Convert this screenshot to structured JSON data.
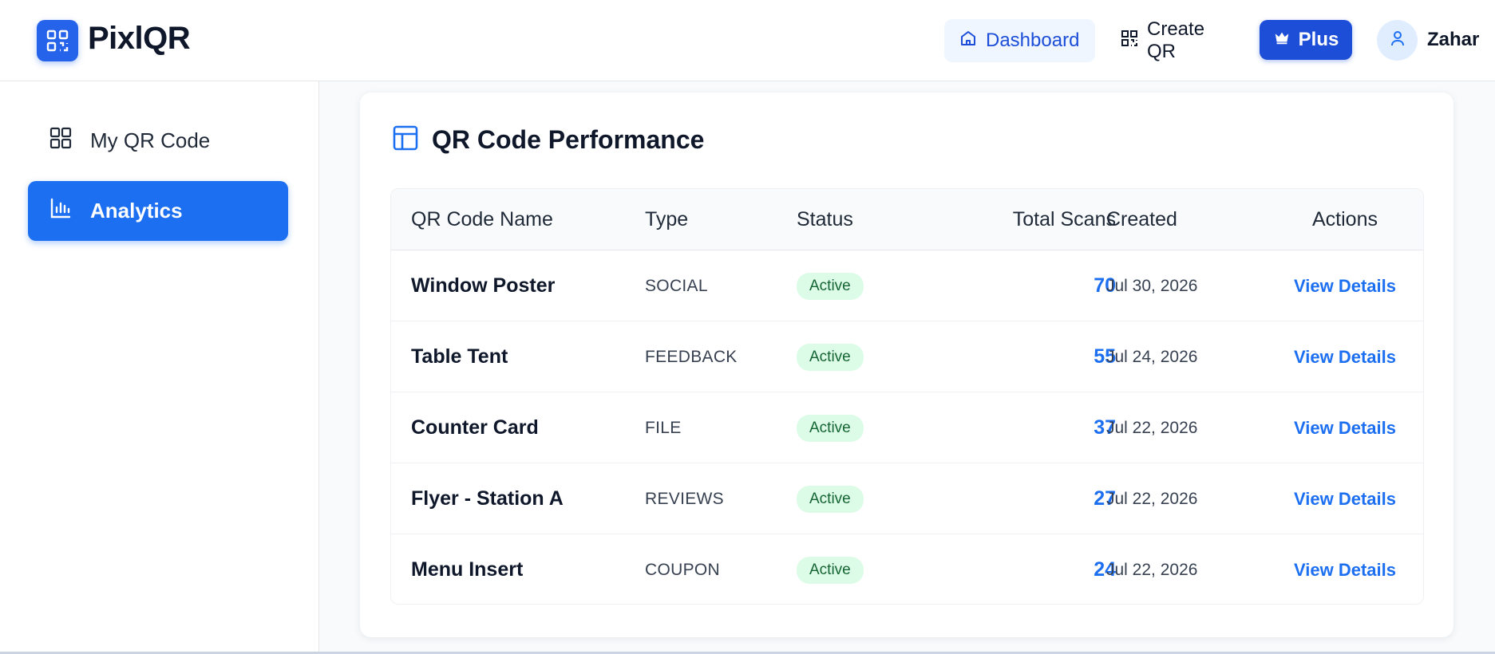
{
  "header": {
    "brand": "PixlQR",
    "nav": {
      "dashboard": "Dashboard",
      "create_qr": "Create QR",
      "plus": "Plus"
    },
    "user": "Zahar"
  },
  "sidebar": {
    "items": [
      {
        "label": "My QR Code",
        "icon": "grid-icon",
        "active": false
      },
      {
        "label": "Analytics",
        "icon": "bar-chart-icon",
        "active": true
      }
    ]
  },
  "card": {
    "title": "QR Code Performance",
    "columns": [
      "QR Code Name",
      "Type",
      "Status",
      "Total Scans",
      "Created",
      "Actions"
    ],
    "rows": [
      {
        "name": "Window Poster",
        "type": "SOCIAL",
        "status": "Active",
        "scans": "70",
        "created": "Jul 30, 2026",
        "action": "View Details"
      },
      {
        "name": "Table Tent",
        "type": "FEEDBACK",
        "status": "Active",
        "scans": "55",
        "created": "Jul 24, 2026",
        "action": "View Details"
      },
      {
        "name": "Counter Card",
        "type": "FILE",
        "status": "Active",
        "scans": "37",
        "created": "Jul 22, 2026",
        "action": "View Details"
      },
      {
        "name": "Flyer - Station A",
        "type": "REVIEWS",
        "status": "Active",
        "scans": "27",
        "created": "Jul 22, 2026",
        "action": "View Details"
      },
      {
        "name": "Menu Insert",
        "type": "COUPON",
        "status": "Active",
        "scans": "24",
        "created": "Jul 22, 2026",
        "action": "View Details"
      }
    ]
  },
  "colors": {
    "primary": "#1d6ff2",
    "primary_dark": "#1d4ed8",
    "status_active_bg": "#dcfce7",
    "status_active_text": "#166534"
  }
}
